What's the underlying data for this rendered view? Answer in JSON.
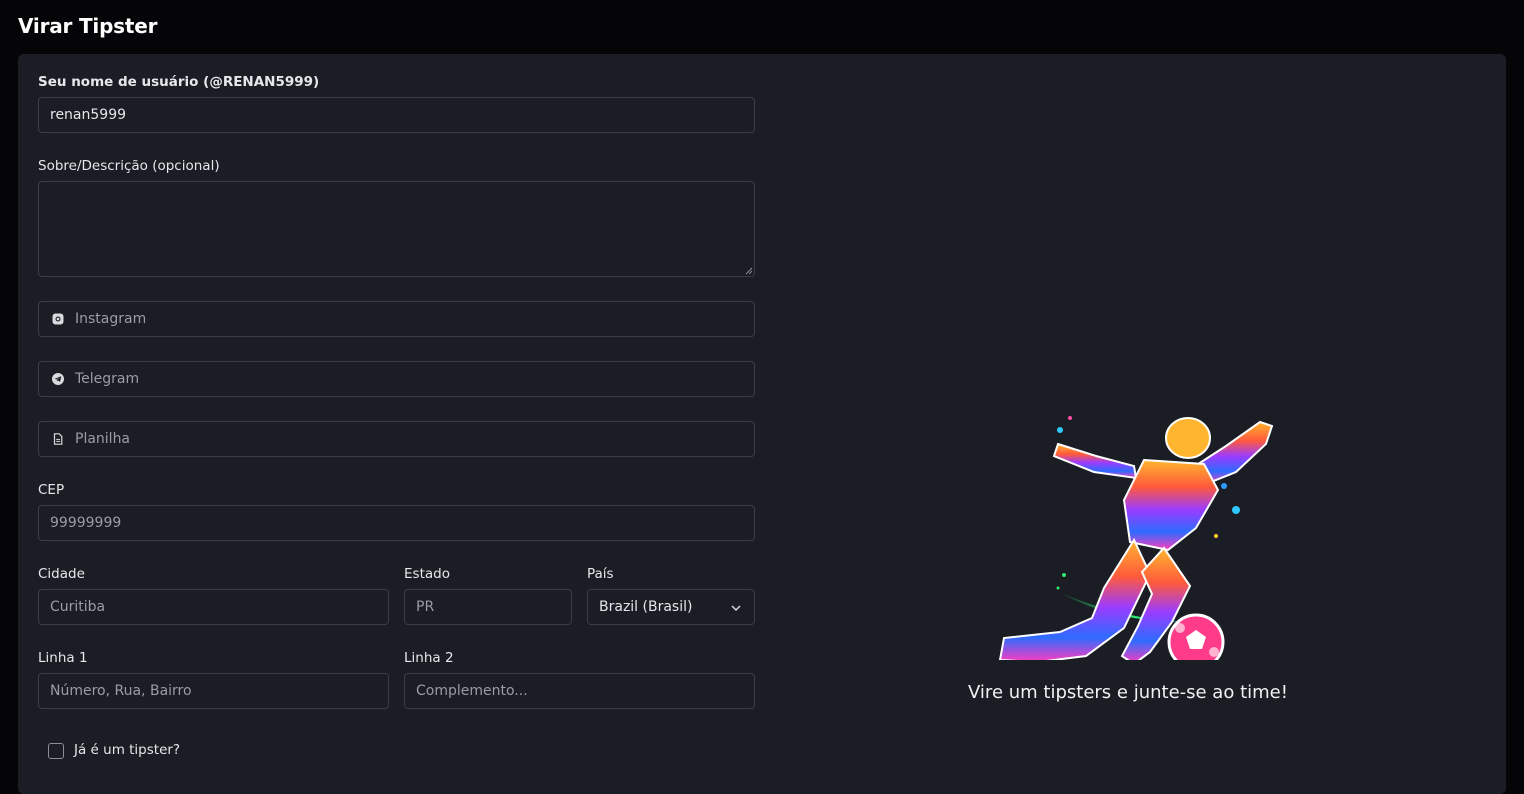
{
  "header": {
    "title": "Virar Tipster"
  },
  "form": {
    "username_label": "Seu nome de usuário (@RENAN5999)",
    "username_value": "renan5999",
    "description_label": "Sobre/Descrição (opcional)",
    "description_value": "",
    "instagram_placeholder": "Instagram",
    "telegram_placeholder": "Telegram",
    "spreadsheet_placeholder": "Planilha",
    "cep_label": "CEP",
    "cep_placeholder": "99999999",
    "city_label": "Cidade",
    "city_placeholder": "Curitiba",
    "state_label": "Estado",
    "state_placeholder": "PR",
    "country_label": "País",
    "country_value": "Brazil (Brasil)",
    "line1_label": "Linha 1",
    "line1_placeholder": "Número, Rua, Bairro",
    "line2_label": "Linha 2",
    "line2_placeholder": "Complemento...",
    "already_tipster_label": "Já é um tipster?",
    "already_tipster_checked": false
  },
  "promo": {
    "tagline": "Vire um tipsters e junte-se ao time!"
  },
  "icons": {
    "instagram": "instagram-icon",
    "telegram": "telegram-icon",
    "spreadsheet": "file-icon",
    "select": "chevron-down-icon"
  }
}
